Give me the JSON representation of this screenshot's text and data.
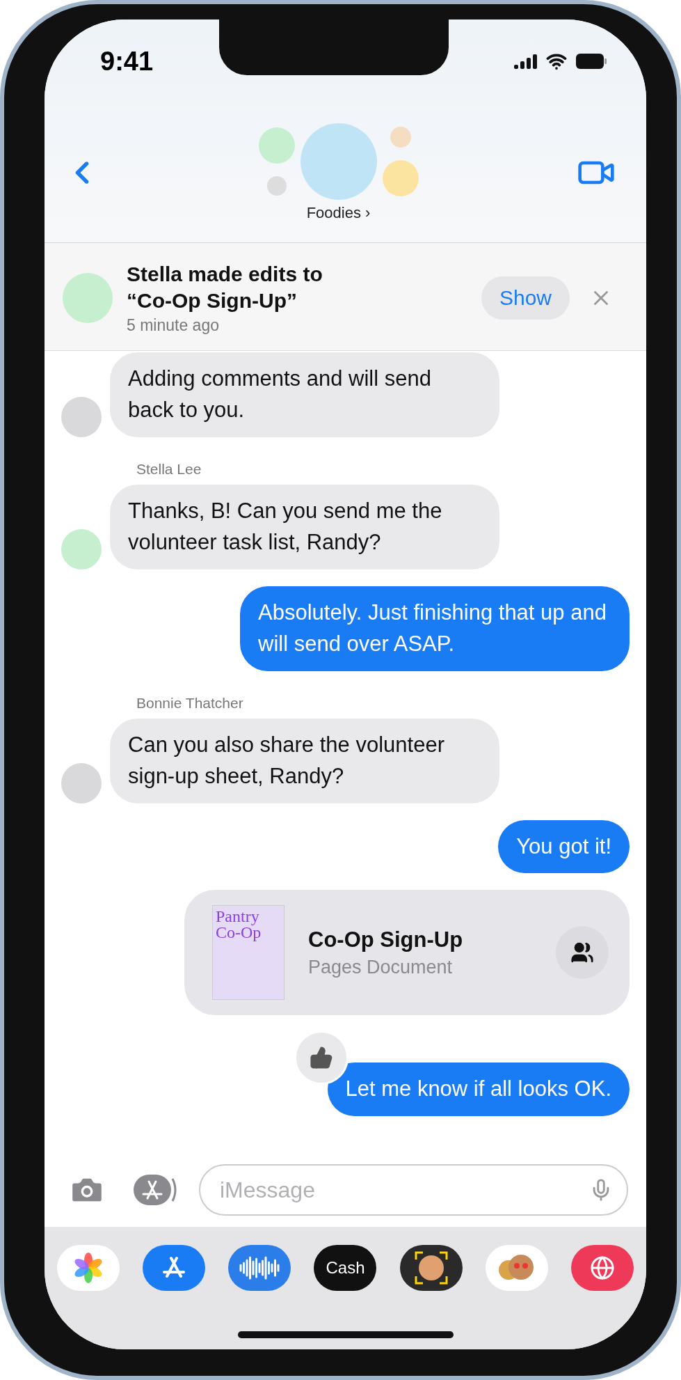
{
  "status_bar": {
    "time": "9:41"
  },
  "header": {
    "group_name": "Foodies",
    "chevron": "›"
  },
  "banner": {
    "title": "Stella made edits to",
    "document": "“Co-Op Sign-Up”",
    "time": "5 minute ago",
    "action": "Show"
  },
  "messages": [
    {
      "kind": "incoming",
      "color": "#d9d9dc",
      "text": "Adding comments and will send back to you.",
      "liked": false
    },
    {
      "kind": "incoming",
      "sender": "Stella Lee",
      "color": "#c6efcf",
      "text": "Thanks, B! Can you send me the volunteer task list, Randy?",
      "liked": false
    },
    {
      "kind": "outgoing",
      "text": "Absolutely. Just finishing that up and will send over ASAP.",
      "liked": false
    },
    {
      "kind": "incoming",
      "sender": "Bonnie Thatcher",
      "color": "#d9d9dc",
      "text": "Can you also share the volunteer sign-up sheet, Randy?",
      "liked": false
    },
    {
      "kind": "outgoing",
      "text": "You got it!",
      "liked": false
    },
    {
      "kind": "attachment",
      "thumb_title": "Pantry Co-Op",
      "title": "Co-Op Sign-Up",
      "subtitle": "Pages Document"
    },
    {
      "kind": "outgoing",
      "text": "Let me know if all looks OK.",
      "liked": true
    }
  ],
  "composer": {
    "placeholder": "iMessage"
  },
  "apps": [
    {
      "kind": "photos"
    },
    {
      "kind": "store"
    },
    {
      "kind": "audio"
    },
    {
      "kind": "cash",
      "label": "Cash"
    },
    {
      "kind": "memoji"
    },
    {
      "kind": "stickers"
    },
    {
      "kind": "search"
    }
  ]
}
